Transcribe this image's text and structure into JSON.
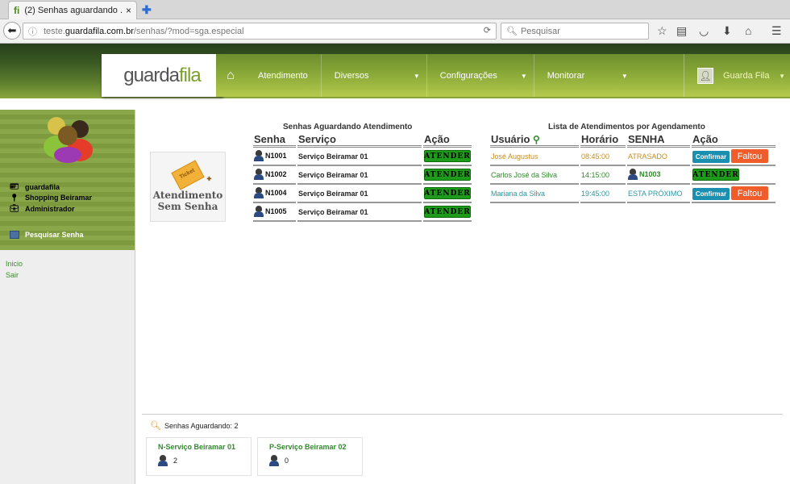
{
  "browser": {
    "tab_title": "(2) Senhas aguardando ...",
    "tab_favicon": "fi",
    "tab_close": "×",
    "url_prefix": "teste.",
    "url_domain": "guardafila.com.br",
    "url_path": "/senhas/?mod=sga.especial",
    "search_placeholder": "Pesquisar"
  },
  "header": {
    "logo_a": "guarda ",
    "logo_b": "fila",
    "menu": [
      "Atendimento",
      "Diversos",
      "Configurações",
      "Monitorar"
    ],
    "user_name": "Guarda Fila"
  },
  "sidebar": {
    "info": [
      "guardafila",
      "Shopping Beiramar",
      "Administrador"
    ],
    "search_label": "Pesquisar Senha",
    "links": [
      "Inicio",
      "Sair"
    ]
  },
  "atendimento": {
    "ticket_word": "Ticket",
    "label_line1": "Atendimento",
    "label_line2": "Sem Senha"
  },
  "waiting": {
    "title": "Senhas Aguardando Atendimento",
    "headers": [
      "Senha",
      "Serviço",
      "Ação"
    ],
    "button_label": "ATENDER",
    "rows": [
      {
        "senha": "N1001",
        "servico": "Serviço Beiramar 01"
      },
      {
        "senha": "N1002",
        "servico": "Serviço Beiramar 01"
      },
      {
        "senha": "N1004",
        "servico": "Serviço Beiramar 01"
      },
      {
        "senha": "N1005",
        "servico": "Serviço Beiramar 01"
      }
    ]
  },
  "agendamento": {
    "title": "Lista de Atendimentos por Agendamento",
    "headers": [
      "Usuário",
      "Horário",
      "SENHA",
      "Ação"
    ],
    "confirm_label": "Confirmar",
    "faltou_label": "Faltou",
    "atender_label": "ATENDER",
    "rows": [
      {
        "usuario": "José Augustus",
        "horario": "08:45:00",
        "senha": "ATRASADO"
      },
      {
        "usuario": "Carlos José da Silva",
        "horario": "14:15:00",
        "senha": "N1003"
      },
      {
        "usuario": "Mariana da Silva",
        "horario": "19:45:00",
        "senha": "ESTA PRÓXIMO"
      }
    ]
  },
  "footer": {
    "aguardando": "Senhas Aguardando: 2",
    "services": [
      {
        "name": "N-Serviço Beiramar 01",
        "count": "2"
      },
      {
        "name": "P-Serviço Beiramar 02",
        "count": "0"
      }
    ]
  }
}
